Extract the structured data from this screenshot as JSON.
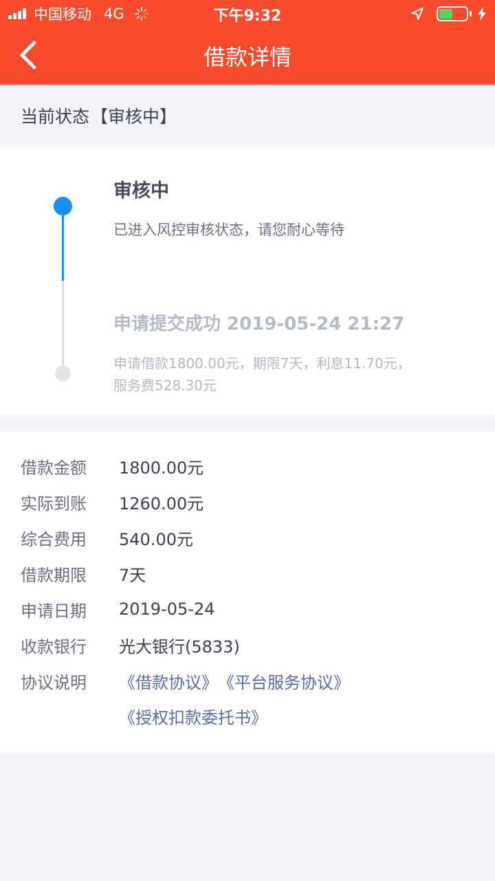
{
  "statusbar": {
    "carrier": "中国移动",
    "network": "4G",
    "time": "下午9:32",
    "battery_level": 0.5
  },
  "header": {
    "title": "借款详情"
  },
  "status": {
    "label": "当前状态",
    "value": "【审核中】"
  },
  "timeline": [
    {
      "title": "审核中",
      "desc": "已进入风控审核状态，请您耐心等待",
      "active": true
    },
    {
      "title": "申请提交成功 2019-05-24 21:27",
      "desc": "申请借款1800.00元，期限7天，利息11.70元，服务费528.30元",
      "active": false
    }
  ],
  "details": [
    {
      "label": "借款金额",
      "value": "1800.00元"
    },
    {
      "label": "实际到账",
      "value": "1260.00元"
    },
    {
      "label": "综合费用",
      "value": "540.00元"
    },
    {
      "label": "借款期限",
      "value": "7天"
    },
    {
      "label": "申请日期",
      "value": "2019-05-24"
    },
    {
      "label": "收款银行",
      "value": "光大银行(5833)"
    }
  ],
  "agreements": {
    "label": "协议说明",
    "links": [
      "《借款协议》",
      "《平台服务协议》",
      "《授权扣款委托书》"
    ]
  },
  "colors": {
    "header_bg": "#fa4a2d",
    "accent_blue": "#1a8cf5",
    "link": "#5a6aa8"
  }
}
